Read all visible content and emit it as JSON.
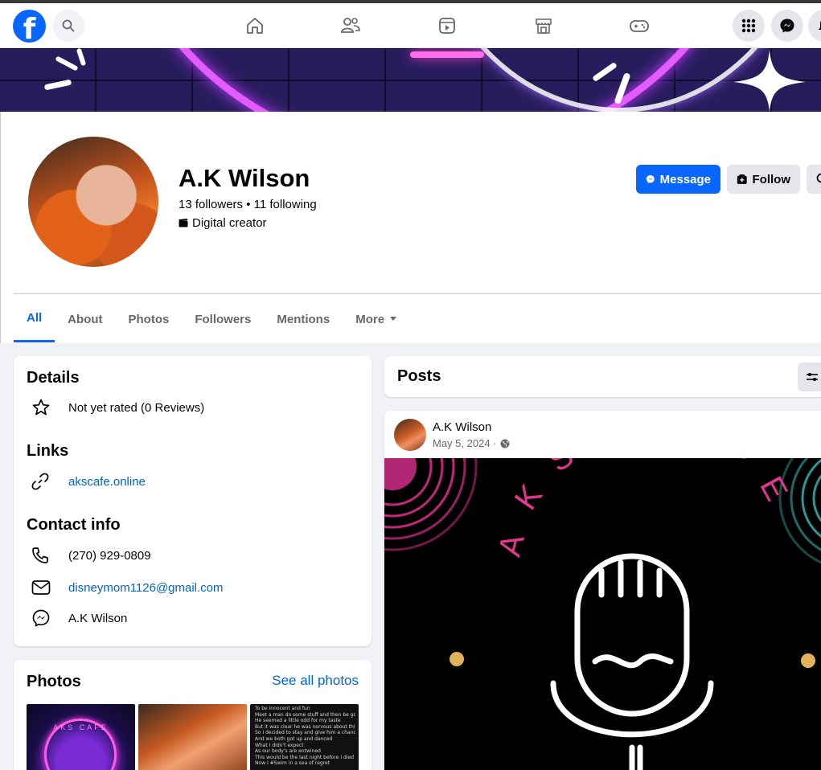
{
  "app": {
    "name": "Facebook"
  },
  "nav": {
    "icons": [
      "home-icon",
      "friends-icon",
      "video-icon",
      "marketplace-icon",
      "gaming-icon"
    ],
    "right_icons": [
      "menu-grid-icon",
      "messenger-icon",
      "notifications-icon"
    ]
  },
  "profile": {
    "name": "A.K Wilson",
    "follow_counts": "13 followers • 11 following",
    "category": "Digital creator",
    "buttons": {
      "message": "Message",
      "follow": "Follow"
    }
  },
  "tabs": [
    {
      "label": "All",
      "active": true
    },
    {
      "label": "About",
      "active": false
    },
    {
      "label": "Photos",
      "active": false
    },
    {
      "label": "Followers",
      "active": false
    },
    {
      "label": "Mentions",
      "active": false
    },
    {
      "label": "More",
      "active": false
    }
  ],
  "details": {
    "title": "Details",
    "rating": "Not yet rated (0 Reviews)",
    "links_title": "Links",
    "website": "akscafe.online",
    "contact_title": "Contact info",
    "phone": "(270) 929-0809",
    "email": "disneymom1126@gmail.com",
    "messenger": "A.K Wilson"
  },
  "photos": {
    "title": "Photos",
    "see_all": "See all photos",
    "thumb1_text": "AKS CAFE",
    "thumb3_lines": [
      "To be innocent and fun",
      "Meet a man do some stuff and then be gone",
      "He seemed a little odd for my taste",
      "But it was clear he was nervous about this date",
      "So I decided to stay and give him a chance",
      "And we both got up and danced",
      "What I didn't expect",
      "As our body's are entwined",
      "This would be the last night before I died",
      "Now I #Swim in a sea of regret"
    ]
  },
  "posts": {
    "title": "Posts",
    "author": "A.K Wilson",
    "date": "May 5, 2024 ·",
    "image_text": "AKS CAFE"
  },
  "colors": {
    "brand": "#0866ff",
    "link": "#0064d1",
    "neon_pink": "#e4368f",
    "neon_teal": "#2fb3b0",
    "dot": "#e2b25a"
  }
}
